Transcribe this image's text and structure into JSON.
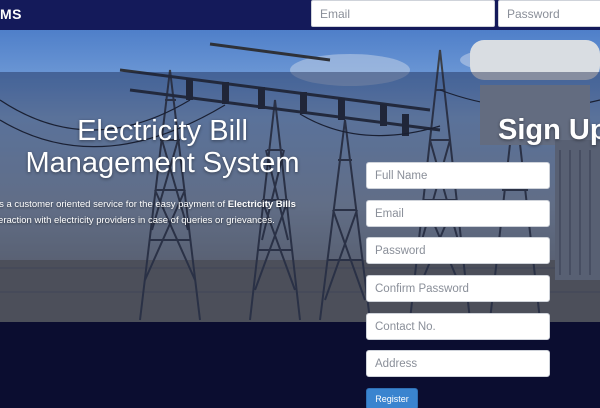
{
  "navbar": {
    "brand": "MS",
    "email_placeholder": "Email",
    "password_placeholder": "Password"
  },
  "hero": {
    "title_line1": "Electricity Bill",
    "title_line2": "Management System",
    "intro_part1": "S is a customer oriented service for the easy payment of ",
    "intro_bold": "Electricity Bills",
    "intro_part2": "interaction with electricity providers in case of queries or grievances."
  },
  "signup": {
    "title": "Sign Up",
    "full_name_placeholder": "Full Name",
    "email_placeholder": "Email",
    "password_placeholder": "Password",
    "confirm_password_placeholder": "Confirm Password",
    "contact_placeholder": "Contact No.",
    "address_placeholder": "Address",
    "register_label": "Register"
  },
  "colors": {
    "navbar": "#141a5a",
    "background": "#0b0d30",
    "register_button": "#3a84cf"
  }
}
